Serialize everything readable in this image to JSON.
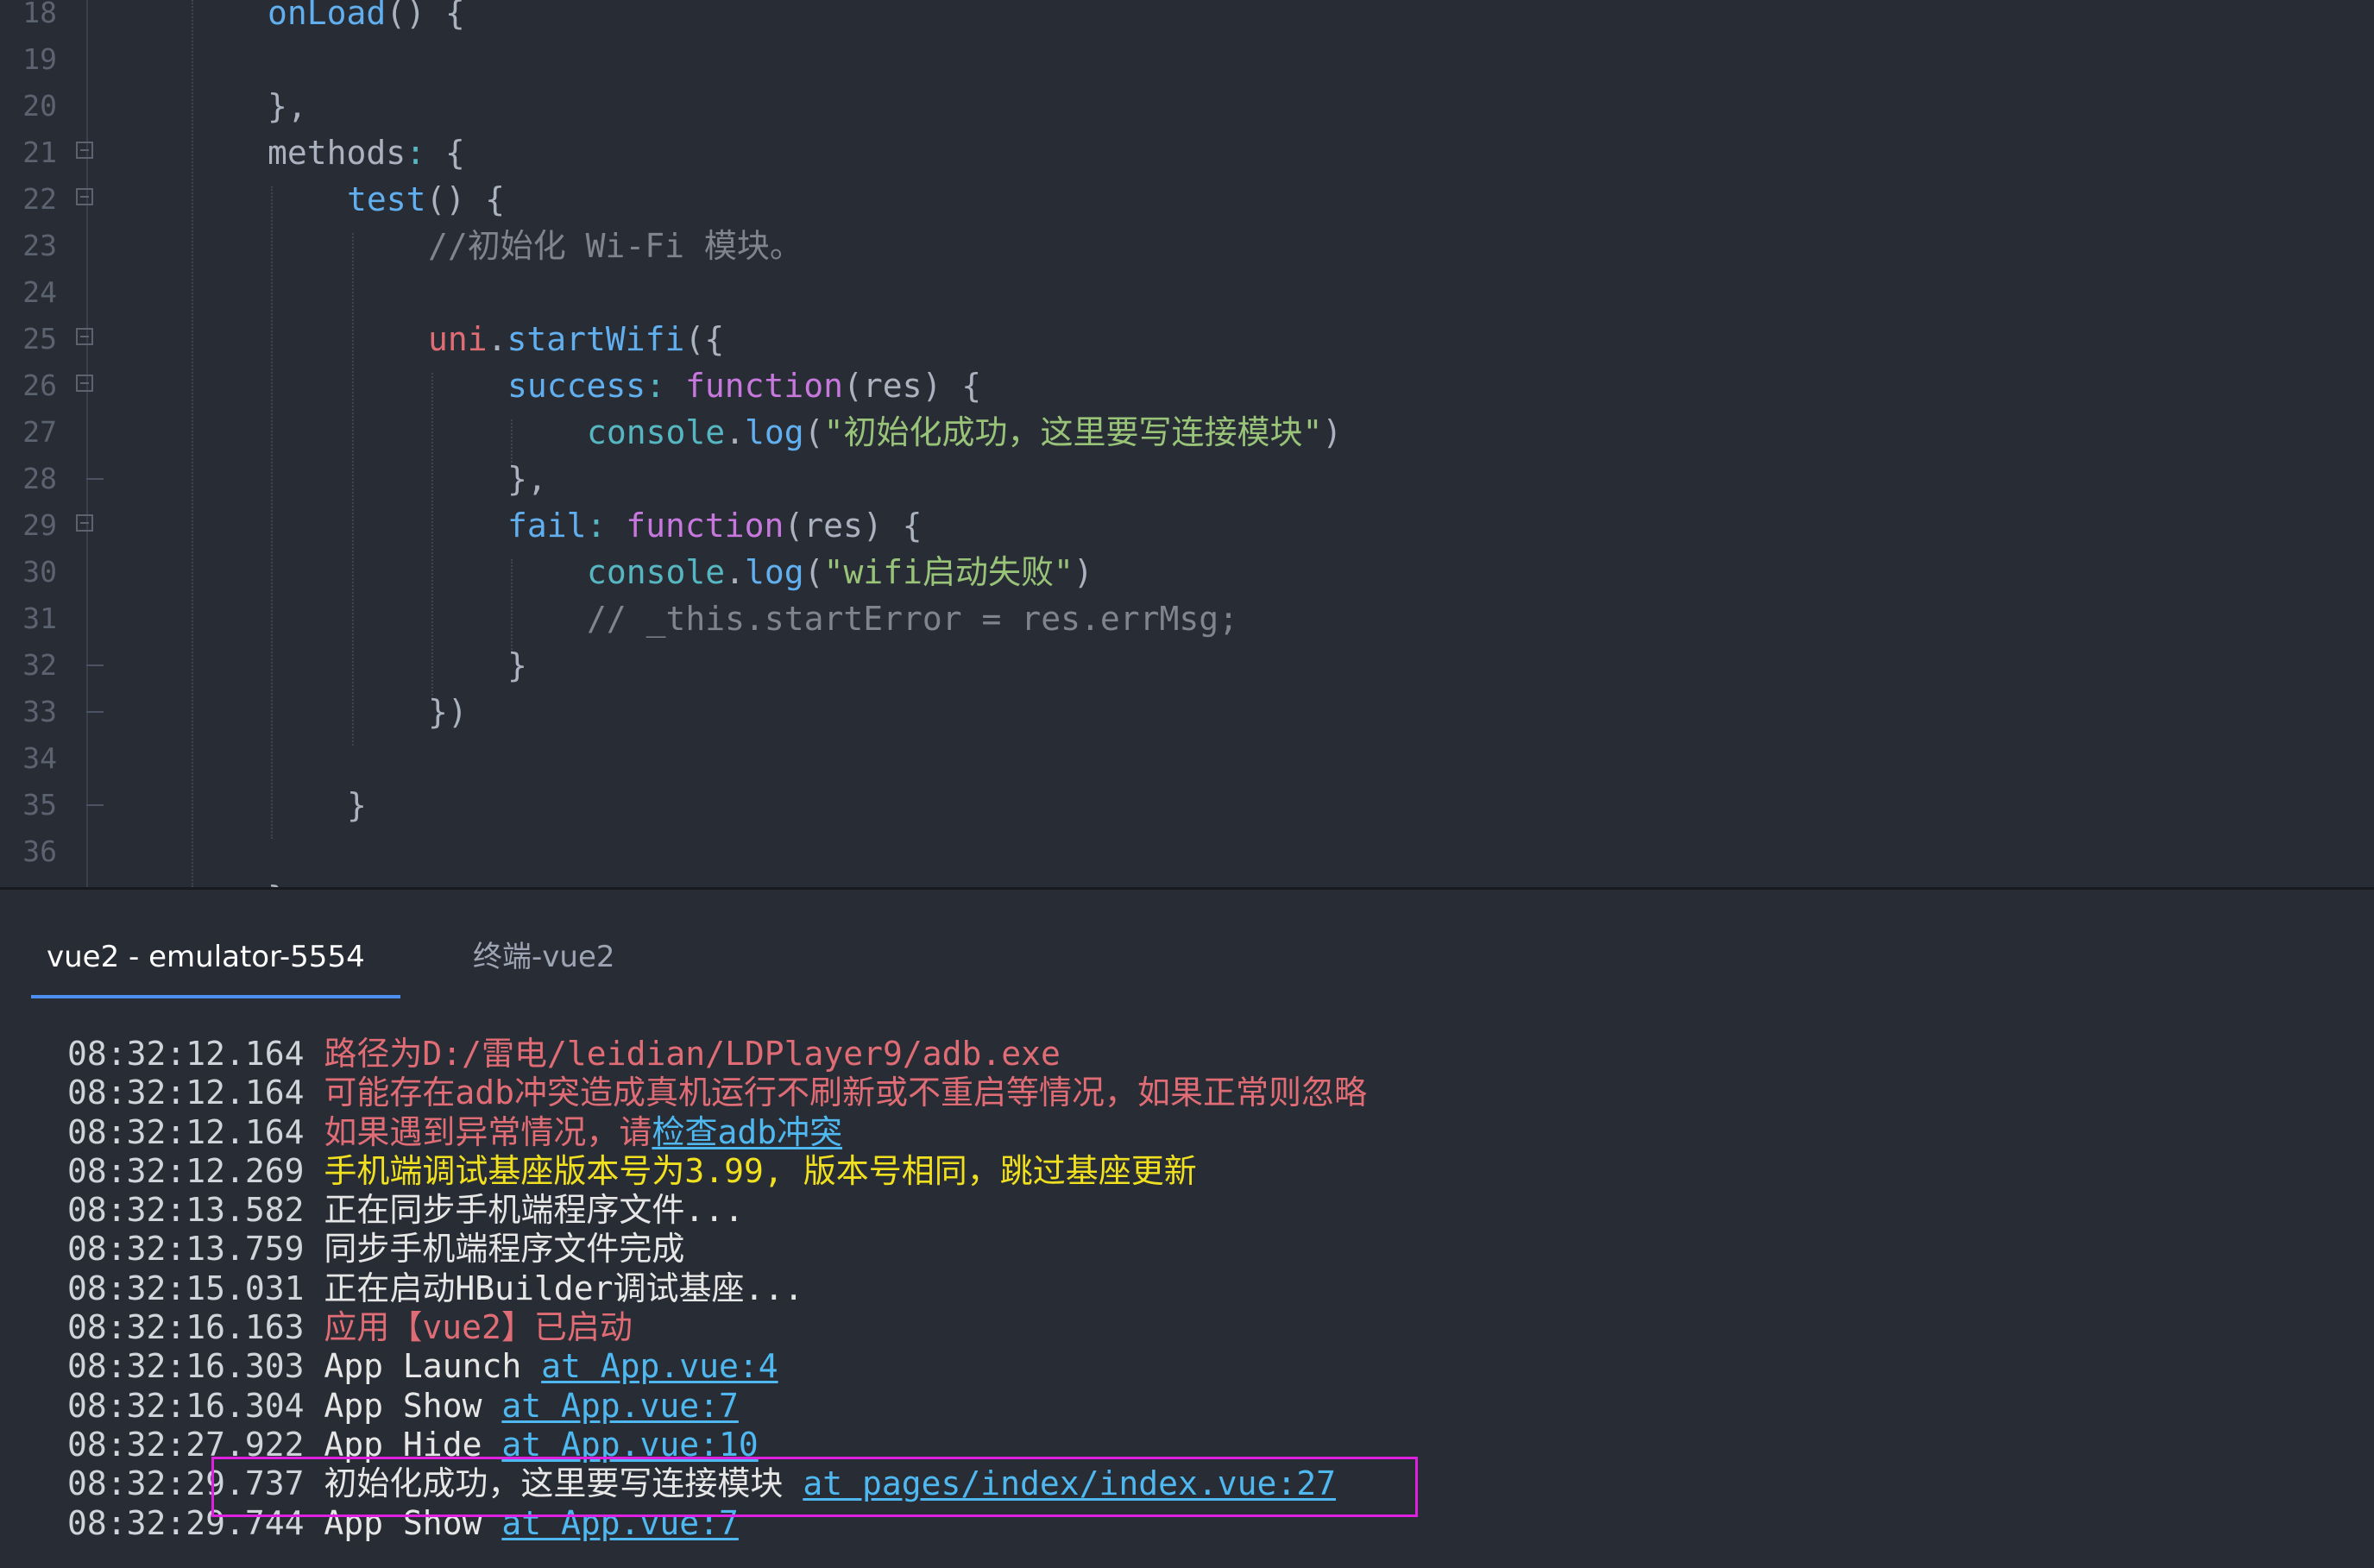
{
  "editor": {
    "lines": [
      {
        "n": "18",
        "segs": [
          [
            "onLoad",
            "blue"
          ],
          [
            "() {",
            "plain"
          ]
        ]
      },
      {
        "n": "19",
        "segs": []
      },
      {
        "n": "20",
        "segs": [
          [
            "},",
            "plain"
          ]
        ]
      },
      {
        "n": "21",
        "segs": [
          [
            "methods",
            "plain"
          ],
          [
            ":",
            "cyan"
          ],
          [
            " {",
            "plain"
          ]
        ]
      },
      {
        "n": "22",
        "segs": [
          [
            "test",
            "blue"
          ],
          [
            "() {",
            "plain"
          ]
        ]
      },
      {
        "n": "23",
        "segs": [
          [
            "//初始化 Wi-Fi 模块。",
            "gray"
          ]
        ]
      },
      {
        "n": "24",
        "segs": []
      },
      {
        "n": "25",
        "segs": [
          [
            "uni",
            "red"
          ],
          [
            ".",
            "plain"
          ],
          [
            "startWifi",
            "blue"
          ],
          [
            "({",
            "plain"
          ]
        ]
      },
      {
        "n": "26",
        "segs": [
          [
            "success",
            "blue"
          ],
          [
            ":",
            "cyan"
          ],
          [
            " ",
            "plain"
          ],
          [
            "function",
            "purple"
          ],
          [
            "(res) {",
            "plain"
          ]
        ]
      },
      {
        "n": "27",
        "segs": [
          [
            "console",
            "cyan"
          ],
          [
            ".",
            "plain"
          ],
          [
            "log",
            "blue"
          ],
          [
            "(",
            "plain"
          ],
          [
            "\"初始化成功，这里要写连接模块\"",
            "green"
          ],
          [
            ")",
            "plain"
          ]
        ]
      },
      {
        "n": "28",
        "segs": [
          [
            "},",
            "plain"
          ]
        ]
      },
      {
        "n": "29",
        "segs": [
          [
            "fail",
            "blue"
          ],
          [
            ":",
            "cyan"
          ],
          [
            " ",
            "plain"
          ],
          [
            "function",
            "purple"
          ],
          [
            "(res) {",
            "plain"
          ]
        ]
      },
      {
        "n": "30",
        "segs": [
          [
            "console",
            "cyan"
          ],
          [
            ".",
            "plain"
          ],
          [
            "log",
            "blue"
          ],
          [
            "(",
            "plain"
          ],
          [
            "\"wifi启动失败\"",
            "green"
          ],
          [
            ")",
            "plain"
          ]
        ]
      },
      {
        "n": "31",
        "segs": [
          [
            "// _this.startError = res.errMsg;",
            "gray"
          ]
        ]
      },
      {
        "n": "32",
        "segs": [
          [
            "}",
            "plain"
          ]
        ]
      },
      {
        "n": "33",
        "segs": [
          [
            "})",
            "plain"
          ]
        ]
      },
      {
        "n": "34",
        "segs": []
      },
      {
        "n": "35",
        "segs": [
          [
            "}",
            "plain"
          ]
        ]
      },
      {
        "n": "36",
        "segs": []
      },
      {
        "n": "",
        "segs": [
          [
            "},",
            "plain"
          ]
        ]
      }
    ]
  },
  "panel": {
    "tabs": {
      "emulator": "vue2 - emulator-5554",
      "terminal": "终端-vue2"
    },
    "log": [
      {
        "time": "08:32:12.164",
        "msg": "路径为D:/雷电/leidian/LDPlayer9/adb.exe",
        "color": "red",
        "link": ""
      },
      {
        "time": "08:32:12.164",
        "msg": "可能存在adb冲突造成真机运行不刷新或不重启等情况，如果正常则忽略",
        "color": "red",
        "link": ""
      },
      {
        "time": "08:32:12.164",
        "msg": "如果遇到异常情况，请",
        "color": "red",
        "link": "检查adb冲突"
      },
      {
        "time": "08:32:12.269",
        "msg": "手机端调试基座版本号为3.99, 版本号相同，跳过基座更新",
        "color": "yellow",
        "link": ""
      },
      {
        "time": "08:32:13.582",
        "msg": "正在同步手机端程序文件...",
        "color": "white",
        "link": ""
      },
      {
        "time": "08:32:13.759",
        "msg": "同步手机端程序文件完成",
        "color": "white",
        "link": ""
      },
      {
        "time": "08:32:15.031",
        "msg": "正在启动HBuilder调试基座...",
        "color": "white",
        "link": ""
      },
      {
        "time": "08:32:16.163",
        "msg": "应用【vue2】已启动",
        "color": "red",
        "link": ""
      },
      {
        "time": "08:32:16.303",
        "msg": "App Launch ",
        "color": "white",
        "link": "at App.vue:4"
      },
      {
        "time": "08:32:16.304",
        "msg": "App Show ",
        "color": "white",
        "link": "at App.vue:7"
      },
      {
        "time": "08:32:27.922",
        "msg": "App Hide ",
        "color": "white",
        "link": "at App.vue:10"
      },
      {
        "time": "08:32:29.737",
        "msg": "初始化成功，这里要写连接模块 ",
        "color": "white",
        "link": "at pages/index/index.vue:27"
      },
      {
        "time": "08:32:29.744",
        "msg": "App Show ",
        "color": "white",
        "link": "at App.vue:7"
      }
    ]
  }
}
